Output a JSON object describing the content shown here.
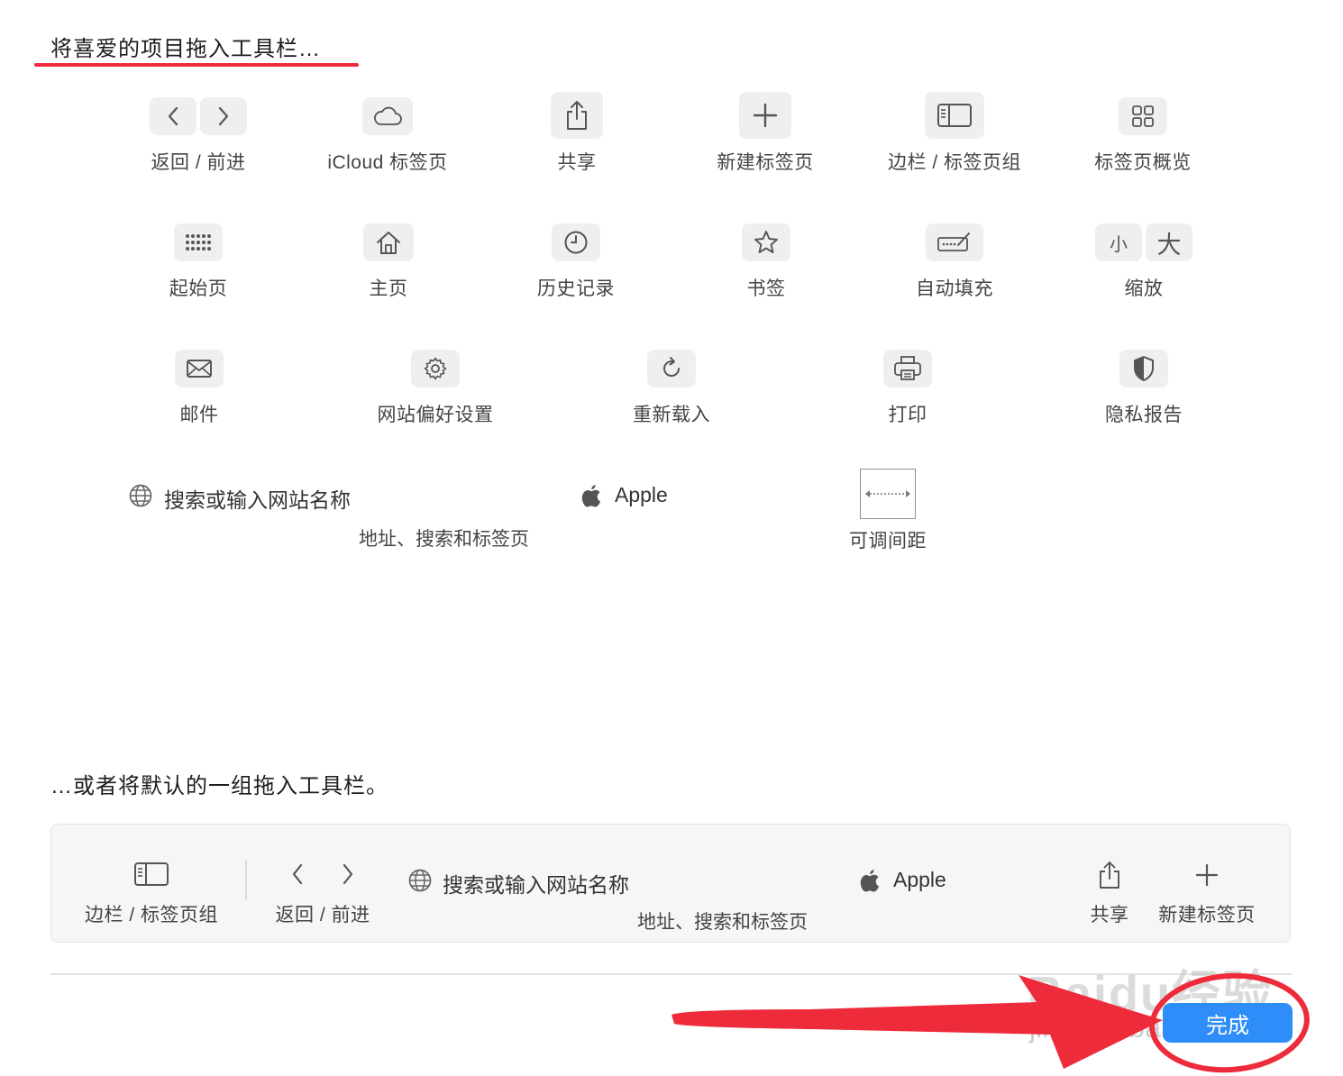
{
  "header": {
    "title": "将喜爱的项目拖入工具栏…"
  },
  "items": {
    "back_forward": "返回 / 前进",
    "icloud": "iCloud 标签页",
    "share": "共享",
    "new_tab": "新建标签页",
    "sidebar": "边栏 / 标签页组",
    "tab_overview": "标签页概览",
    "start_page": "起始页",
    "home": "主页",
    "history": "历史记录",
    "bookmarks": "书签",
    "autofill": "自动填充",
    "zoom": "缩放",
    "zoom_small": "小",
    "zoom_large": "大",
    "mail": "邮件",
    "site_settings": "网站偏好设置",
    "reload": "重新载入",
    "print": "打印",
    "privacy": "隐私报告",
    "flex_space": "可调间距"
  },
  "address": {
    "placeholder": "搜索或输入网站名称",
    "site": "Apple",
    "label": "地址、搜索和标签页"
  },
  "default_set": {
    "title": "…或者将默认的一组拖入工具栏。",
    "sidebar": "边栏 / 标签页组",
    "back_forward": "返回 / 前进",
    "placeholder": "搜索或输入网站名称",
    "site": "Apple",
    "address_label": "地址、搜索和标签页",
    "share": "共享",
    "new_tab": "新建标签页"
  },
  "footer": {
    "done": "完成"
  },
  "watermark": {
    "line1": "Baidu经验",
    "line2": "jingyan.baidu.com"
  },
  "colors": {
    "accent": "#2f8dfa",
    "annotation": "#ee2b3b"
  }
}
